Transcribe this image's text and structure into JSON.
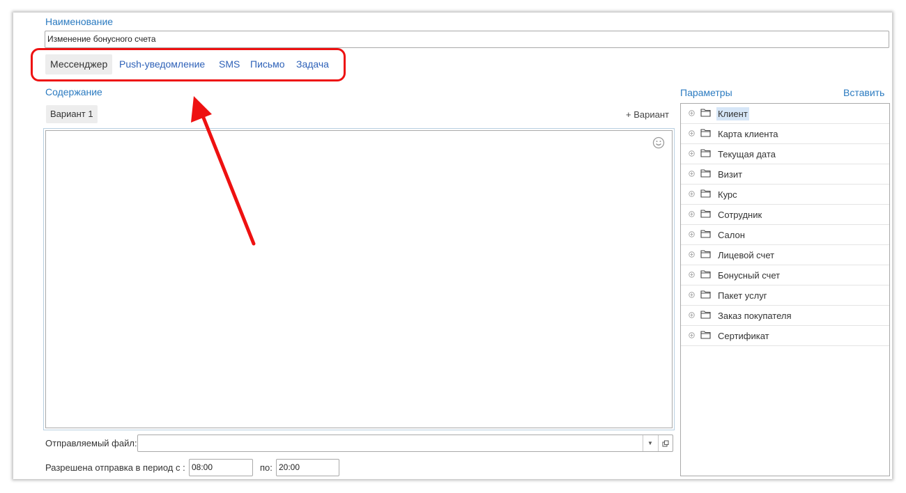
{
  "form": {
    "name_label": "Наименование",
    "name_value": "Изменение бонусного счета"
  },
  "tabs": [
    {
      "label": "Мессенджер",
      "active": true
    },
    {
      "label": "Push-уведомление",
      "active": false
    },
    {
      "label": "SMS",
      "active": false
    },
    {
      "label": "Письмо",
      "active": false
    },
    {
      "label": "Задача",
      "active": false
    }
  ],
  "content": {
    "label": "Содержание",
    "variant_tab": "Вариант 1",
    "add_variant": "+ Вариант",
    "emoji_icon": "smiley-icon"
  },
  "params": {
    "label": "Параметры",
    "insert_label": "Вставить",
    "items": [
      {
        "label": "Клиент",
        "selected": true
      },
      {
        "label": "Карта клиента",
        "selected": false
      },
      {
        "label": "Текущая дата",
        "selected": false
      },
      {
        "label": "Визит",
        "selected": false
      },
      {
        "label": "Курс",
        "selected": false
      },
      {
        "label": "Сотрудник",
        "selected": false
      },
      {
        "label": "Салон",
        "selected": false
      },
      {
        "label": "Лицевой счет",
        "selected": false
      },
      {
        "label": "Бонусный счет",
        "selected": false
      },
      {
        "label": "Пакет услуг",
        "selected": false
      },
      {
        "label": "Заказ покупателя",
        "selected": false
      },
      {
        "label": "Сертификат",
        "selected": false
      }
    ]
  },
  "file": {
    "label": "Отправляемый файл:",
    "value": ""
  },
  "period": {
    "label": "Разрешена отправка в период с :",
    "from_value": "08:00",
    "to_label": "по:",
    "to_value": "20:00"
  },
  "colors": {
    "link_blue": "#2a7ac0",
    "highlight_red": "#ee1111"
  }
}
